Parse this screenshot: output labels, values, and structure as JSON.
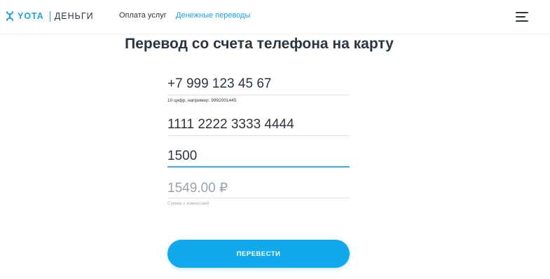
{
  "header": {
    "logo_yota": "YOTA",
    "logo_dengi": "ДЕНЬГИ",
    "nav": [
      {
        "label": "Оплата услуг"
      },
      {
        "label": "Денежные переводы",
        "active": true
      }
    ],
    "menu_icon": "hamburger-menu-icon"
  },
  "page": {
    "title": "Перевод со счета телефона на карту"
  },
  "form": {
    "phone": {
      "value": "+7 999 123 45 67",
      "hint": "10 цифр, например: 9992001445"
    },
    "card": {
      "value": "1111 2222 3333 4444"
    },
    "amount": {
      "value": "1500"
    },
    "total": {
      "value": "1549.00 ₽",
      "hint": "Сумма с комиссией"
    },
    "submit_label": "ПЕРЕВЕСТИ"
  },
  "colors": {
    "accent": "#1aa3e8",
    "button": "#11a9eb",
    "text": "#2b3640",
    "muted": "#9aa3ab"
  }
}
